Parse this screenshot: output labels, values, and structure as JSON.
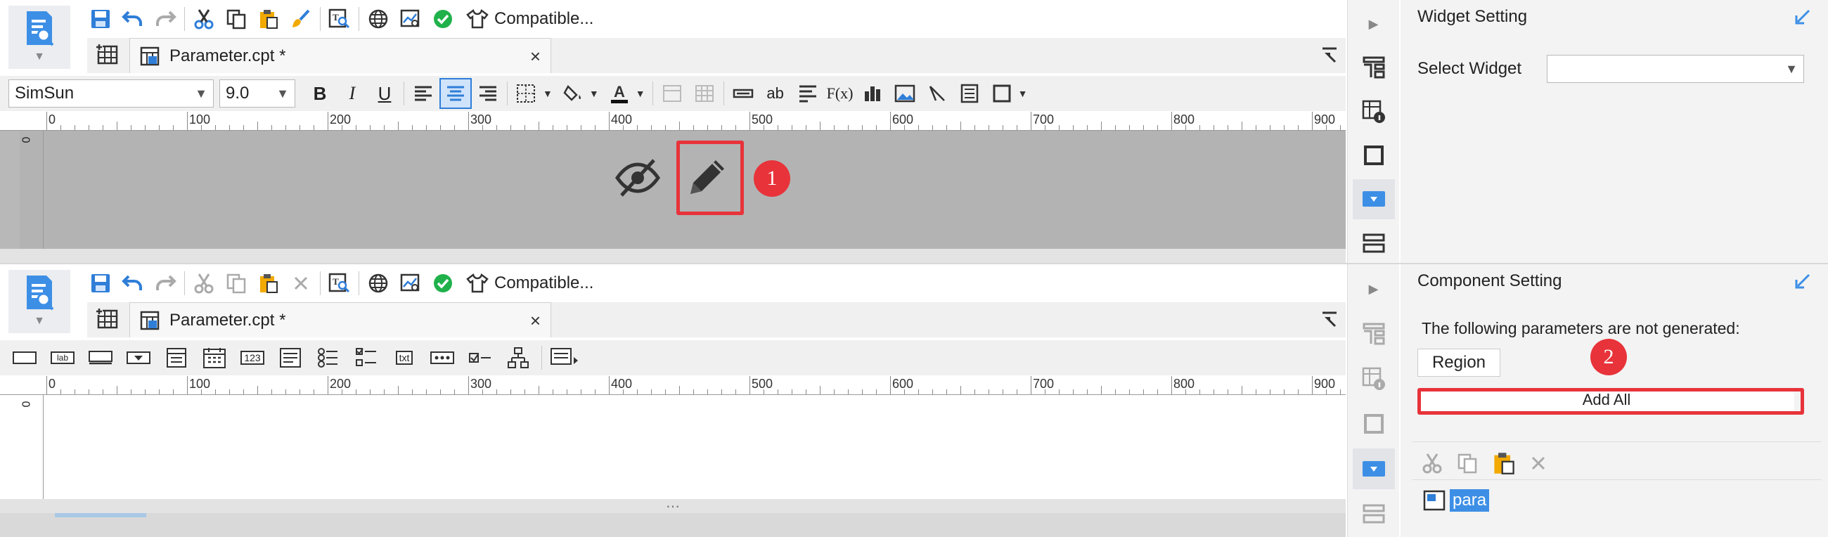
{
  "top": {
    "toolbar": {
      "compatible_label": "Compatible..."
    },
    "tab": {
      "file_name": "Parameter.cpt *",
      "close_glyph": "×"
    },
    "format": {
      "font_name": "SimSun",
      "font_size": "9.0",
      "bold": "B",
      "italic": "I",
      "underline": "U",
      "text_sample": "ab",
      "formula_label": "F(x)"
    },
    "ruler": {
      "labels": [
        "0",
        "100",
        "200",
        "300",
        "400",
        "500",
        "600",
        "700",
        "800",
        "900"
      ],
      "vertical_label": "0"
    },
    "canvas": {
      "eye_icon": "eye-slash-icon",
      "edit_icon": "pencil-icon"
    },
    "right_panel": {
      "title": "Widget Setting",
      "select_widget_label": "Select Widget",
      "select_widget_value": ""
    },
    "annotation_badge": "1"
  },
  "bottom": {
    "toolbar": {
      "compatible_label": "Compatible..."
    },
    "tab": {
      "file_name": "Parameter.cpt *",
      "close_glyph": "×"
    },
    "widgets": {
      "label_text": "lab",
      "number_text": "123",
      "txt_text": "txt"
    },
    "ruler": {
      "labels": [
        "0",
        "100",
        "200",
        "300",
        "400",
        "500",
        "600",
        "700",
        "800",
        "900"
      ],
      "vertical_label": "0"
    },
    "right_panel": {
      "title": "Component Setting",
      "not_generated_text": "The following parameters are not generated:",
      "param_chip": "Region",
      "add_all_label": "Add All",
      "tree_item": "para"
    },
    "annotation_badge": "2",
    "resize_grip": "⋯"
  },
  "colors": {
    "accent": "#3d8fe6",
    "red": "#e8333a",
    "green": "#20b14b",
    "toolbar_bg": "#f0f0f0"
  }
}
